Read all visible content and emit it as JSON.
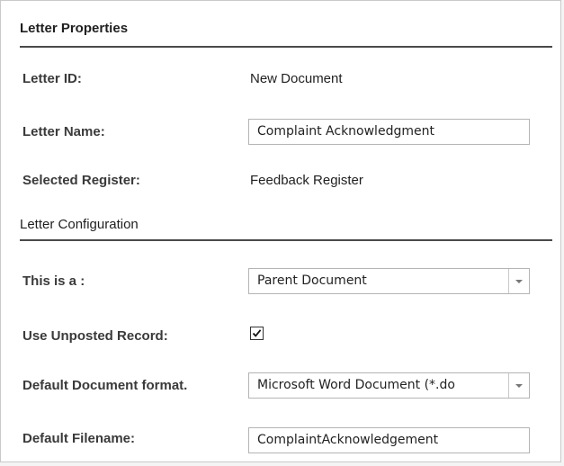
{
  "sections": {
    "letter_properties": "Letter Properties",
    "letter_configuration": "Letter Configuration"
  },
  "fields": {
    "letter_id": {
      "label": "Letter ID:",
      "value": "New Document"
    },
    "letter_name": {
      "label": "Letter Name:",
      "value": "Complaint Acknowledgment"
    },
    "selected_register": {
      "label": "Selected Register:",
      "value": "Feedback Register"
    },
    "document_type": {
      "label": "This is a :",
      "value": "Parent Document"
    },
    "use_unposted_record": {
      "label": "Use Unposted Record:",
      "checked": true
    },
    "default_document_format": {
      "label": "Default Document format.",
      "value": "Microsoft Word Document (*.do"
    },
    "default_filename": {
      "label": "Default Filename:",
      "value": "ComplaintAcknowledgement"
    }
  }
}
